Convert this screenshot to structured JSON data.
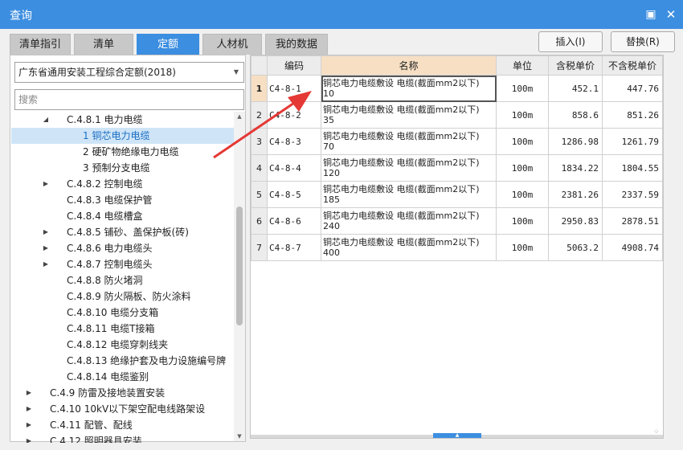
{
  "window": {
    "title": "查询"
  },
  "tabs": [
    {
      "label": "清单指引",
      "active": false
    },
    {
      "label": "清单",
      "active": false
    },
    {
      "label": "定额",
      "active": true
    },
    {
      "label": "人材机",
      "active": false
    },
    {
      "label": "我的数据",
      "active": false
    }
  ],
  "buttons": {
    "insert": "插入(I)",
    "replace": "替换(R)"
  },
  "left": {
    "library": "广东省通用安装工程综合定额(2018)",
    "search_placeholder": "搜索"
  },
  "tree": [
    {
      "label": "C.4.8.1 电力电缆",
      "arrow": "expanded",
      "level": 2
    },
    {
      "label": "1 铜芯电力电缆",
      "arrow": "none",
      "level": 3,
      "selected": true
    },
    {
      "label": "2 硬矿物绝缘电力电缆",
      "arrow": "none",
      "level": 3
    },
    {
      "label": "3 预制分支电缆",
      "arrow": "none",
      "level": 3
    },
    {
      "label": "C.4.8.2 控制电缆",
      "arrow": "collapsed",
      "level": 2
    },
    {
      "label": "C.4.8.3 电缆保护管",
      "arrow": "none",
      "level": 2
    },
    {
      "label": "C.4.8.4 电缆槽盒",
      "arrow": "none",
      "level": 2
    },
    {
      "label": "C.4.8.5 铺砂、盖保护板(砖)",
      "arrow": "collapsed",
      "level": 2
    },
    {
      "label": "C.4.8.6 电力电缆头",
      "arrow": "collapsed",
      "level": 2
    },
    {
      "label": "C.4.8.7 控制电缆头",
      "arrow": "collapsed",
      "level": 2
    },
    {
      "label": "C.4.8.8 防火堵洞",
      "arrow": "none",
      "level": 2
    },
    {
      "label": "C.4.8.9 防火隔板、防火涂料",
      "arrow": "none",
      "level": 2
    },
    {
      "label": "C.4.8.10 电缆分支箱",
      "arrow": "none",
      "level": 2
    },
    {
      "label": "C.4.8.11 电缆T接箱",
      "arrow": "none",
      "level": 2
    },
    {
      "label": "C.4.8.12 电缆穿刺线夹",
      "arrow": "none",
      "level": 2
    },
    {
      "label": "C.4.8.13 绝缘护套及电力设施编号牌",
      "arrow": "none",
      "level": 2
    },
    {
      "label": "C.4.8.14 电缆鉴别",
      "arrow": "none",
      "level": 2
    },
    {
      "label": "C.4.9 防雷及接地装置安装",
      "arrow": "collapsed",
      "level": 1
    },
    {
      "label": "C.4.10 10kV以下架空配电线路架设",
      "arrow": "collapsed",
      "level": 1
    },
    {
      "label": "C.4.11 配管、配线",
      "arrow": "collapsed",
      "level": 1
    },
    {
      "label": "C.4.12 照明器具安装",
      "arrow": "collapsed",
      "level": 1
    }
  ],
  "table": {
    "headers": {
      "code": "编码",
      "name": "名称",
      "unit": "单位",
      "price_tax": "含税单价",
      "price_notax": "不含税单价"
    },
    "rows": [
      {
        "num": "1",
        "code": "C4-8-1",
        "name1": "铜芯电力电缆敷设 电缆(截面mm2以下)",
        "name2": "10",
        "unit": "100m",
        "price_tax": "452.1",
        "price_notax": "447.76"
      },
      {
        "num": "2",
        "code": "C4-8-2",
        "name1": "铜芯电力电缆敷设 电缆(截面mm2以下)",
        "name2": "35",
        "unit": "100m",
        "price_tax": "858.6",
        "price_notax": "851.26"
      },
      {
        "num": "3",
        "code": "C4-8-3",
        "name1": "铜芯电力电缆敷设 电缆(截面mm2以下)",
        "name2": "70",
        "unit": "100m",
        "price_tax": "1286.98",
        "price_notax": "1261.79"
      },
      {
        "num": "4",
        "code": "C4-8-4",
        "name1": "铜芯电力电缆敷设 电缆(截面mm2以下)",
        "name2": "120",
        "unit": "100m",
        "price_tax": "1834.22",
        "price_notax": "1804.55"
      },
      {
        "num": "5",
        "code": "C4-8-5",
        "name1": "铜芯电力电缆敷设 电缆(截面mm2以下)",
        "name2": "185",
        "unit": "100m",
        "price_tax": "2381.26",
        "price_notax": "2337.59"
      },
      {
        "num": "6",
        "code": "C4-8-6",
        "name1": "铜芯电力电缆敷设 电缆(截面mm2以下)",
        "name2": "240",
        "unit": "100m",
        "price_tax": "2950.83",
        "price_notax": "2878.51"
      },
      {
        "num": "7",
        "code": "C4-8-7",
        "name1": "铜芯电力电缆敷设 电缆(截面mm2以下)",
        "name2": "400",
        "unit": "100m",
        "price_tax": "5063.2",
        "price_notax": "4908.74"
      }
    ]
  },
  "colors": {
    "accent": "#3c8ee0",
    "annotation_arrow": "#e53935",
    "selected_bg": "#cfe5f7",
    "header_highlight": "#f7dfc4"
  },
  "icons": {
    "restore": "restore-icon",
    "close": "close-icon",
    "dropdown": "chevron-down-icon"
  }
}
